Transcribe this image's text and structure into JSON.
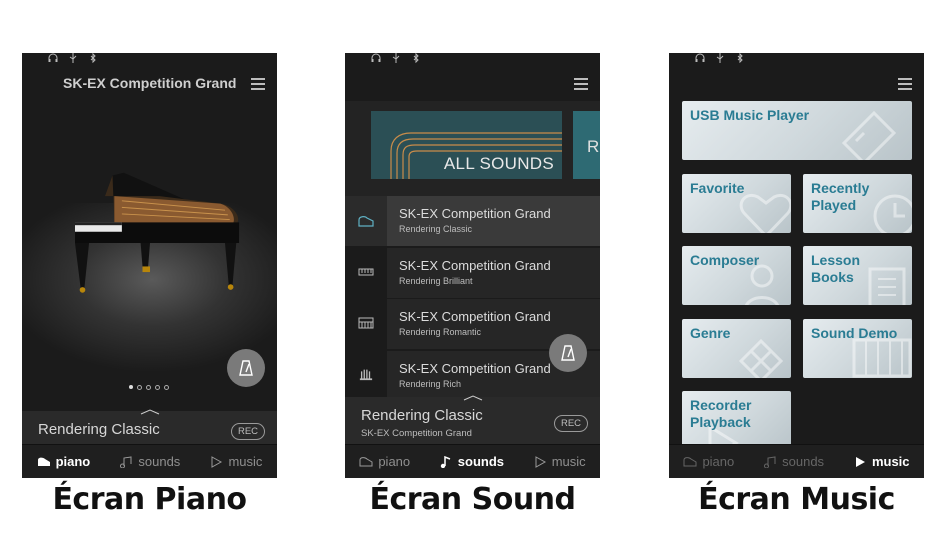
{
  "colors": {
    "accent": "#2a7c93",
    "phone_bg": "#1b1b1b",
    "tile_bg": "#d5dde1"
  },
  "nav": {
    "piano": "piano",
    "sounds": "sounds",
    "music": "music"
  },
  "rec_label": "REC",
  "piano_screen": {
    "title": "SK-EX Competition Grand",
    "bottom_title": "Rendering Classic",
    "page_count": 5,
    "active_page": 1,
    "caption": "Écran Piano"
  },
  "sound_screen": {
    "banner_label": "ALL SOUNDS",
    "banner_next_letter": "R",
    "items": [
      {
        "name": "SK-EX Competition Grand",
        "sub": "Rendering Classic",
        "icon": "grand-piano-icon"
      },
      {
        "name": "SK-EX Competition Grand",
        "sub": "Rendering Brilliant",
        "icon": "electric-piano-icon"
      },
      {
        "name": "SK-EX Competition Grand",
        "sub": "Rendering Romantic",
        "icon": "keyboard-icon"
      },
      {
        "name": "SK-EX Competition Grand",
        "sub": "Rendering Rich",
        "icon": "organ-icon"
      }
    ],
    "bottom_title": "Rendering Classic",
    "bottom_sub": "SK-EX Competition Grand",
    "caption": "Écran Sound"
  },
  "music_screen": {
    "tiles": {
      "usb": "USB Music Player",
      "favorite": "Favorite",
      "recently_played": "Recently Played",
      "composer": "Composer",
      "lesson_books": "Lesson Books",
      "genre": "Genre",
      "sound_demo": "Sound Demo",
      "recorder_playback": "Recorder Playback"
    },
    "caption": "Écran Music"
  }
}
